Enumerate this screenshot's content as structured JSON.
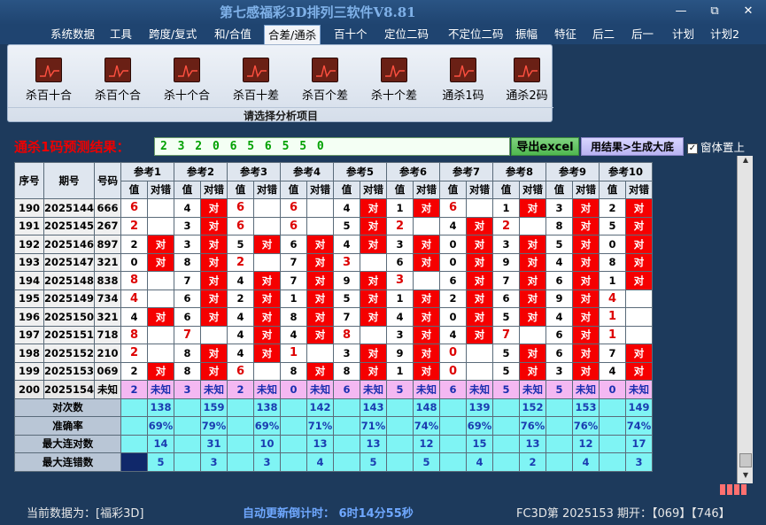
{
  "app_title": "第七感福彩3D排列三软件V8.81",
  "window_controls": {
    "minimize": "—",
    "maximize": "⧉",
    "close": "✕"
  },
  "menu": [
    "系统数据",
    "工具",
    "跨度/复式",
    "和/合值",
    "合差/通杀",
    "百十个",
    "定位二码",
    "不定位二码",
    "振幅",
    "特征",
    "后二",
    "后一",
    "计划",
    "计划2"
  ],
  "active_menu": "合差/通杀",
  "ribbon": {
    "buttons": [
      "杀百十合",
      "杀百个合",
      "杀十个合",
      "杀百十差",
      "杀百个差",
      "杀十个差",
      "通杀1码",
      "通杀2码"
    ],
    "caption": "请选择分析项目"
  },
  "prediction": {
    "label": "通杀1码预测结果：",
    "value": "2 3 2 0 6 5 6 5 5 0",
    "export_label": "导出excel",
    "generate_label": "用结果>生成大底",
    "ontop_label": "窗体置上",
    "ontop_checked": "✓"
  },
  "table": {
    "head_seq": "序号",
    "head_period": "期号",
    "head_num": "号码",
    "refs": [
      "参考1",
      "参考2",
      "参考3",
      "参考4",
      "参考5",
      "参考6",
      "参考7",
      "参考8",
      "参考9",
      "参考10"
    ],
    "sub_val": "值",
    "sub_result": "对错",
    "hit": "对",
    "rows": [
      {
        "seq": "190",
        "period": "2025144",
        "num": "666",
        "vals": [
          "6",
          "4",
          "6",
          "6",
          "4",
          "1",
          "6",
          "1",
          "3",
          "2"
        ],
        "hits": [
          0,
          1,
          0,
          0,
          1,
          1,
          0,
          1,
          1,
          1
        ]
      },
      {
        "seq": "191",
        "period": "2025145",
        "num": "267",
        "vals": [
          "2",
          "3",
          "6",
          "6",
          "5",
          "2",
          "4",
          "2",
          "8",
          "5"
        ],
        "hits": [
          0,
          1,
          0,
          0,
          1,
          0,
          1,
          0,
          1,
          1
        ]
      },
      {
        "seq": "192",
        "period": "2025146",
        "num": "897",
        "vals": [
          "2",
          "3",
          "5",
          "6",
          "4",
          "3",
          "0",
          "3",
          "5",
          "0"
        ],
        "hits": [
          1,
          1,
          1,
          1,
          1,
          1,
          1,
          1,
          1,
          1
        ]
      },
      {
        "seq": "193",
        "period": "2025147",
        "num": "321",
        "vals": [
          "0",
          "8",
          "2",
          "7",
          "3",
          "6",
          "0",
          "9",
          "4",
          "8"
        ],
        "hits": [
          1,
          1,
          0,
          1,
          0,
          1,
          1,
          1,
          1,
          1
        ]
      },
      {
        "seq": "194",
        "period": "2025148",
        "num": "838",
        "vals": [
          "8",
          "7",
          "4",
          "7",
          "9",
          "3",
          "6",
          "7",
          "6",
          "1"
        ],
        "hits": [
          0,
          1,
          1,
          1,
          1,
          0,
          1,
          1,
          1,
          1
        ]
      },
      {
        "seq": "195",
        "period": "2025149",
        "num": "734",
        "vals": [
          "4",
          "6",
          "2",
          "1",
          "5",
          "1",
          "2",
          "6",
          "9",
          "4"
        ],
        "hits": [
          0,
          1,
          1,
          1,
          1,
          1,
          1,
          1,
          1,
          0
        ]
      },
      {
        "seq": "196",
        "period": "2025150",
        "num": "321",
        "vals": [
          "4",
          "6",
          "4",
          "8",
          "7",
          "4",
          "0",
          "5",
          "4",
          "1"
        ],
        "hits": [
          1,
          1,
          1,
          1,
          1,
          1,
          1,
          1,
          1,
          0
        ]
      },
      {
        "seq": "197",
        "period": "2025151",
        "num": "718",
        "vals": [
          "8",
          "7",
          "4",
          "4",
          "8",
          "3",
          "4",
          "7",
          "6",
          "1"
        ],
        "hits": [
          0,
          0,
          1,
          1,
          0,
          1,
          1,
          0,
          1,
          0
        ]
      },
      {
        "seq": "198",
        "period": "2025152",
        "num": "210",
        "vals": [
          "2",
          "8",
          "4",
          "1",
          "3",
          "9",
          "0",
          "5",
          "6",
          "7"
        ],
        "hits": [
          0,
          1,
          1,
          0,
          1,
          1,
          0,
          1,
          1,
          1
        ]
      },
      {
        "seq": "199",
        "period": "2025153",
        "num": "069",
        "vals": [
          "2",
          "8",
          "6",
          "8",
          "8",
          "1",
          "0",
          "5",
          "3",
          "4"
        ],
        "hits": [
          1,
          1,
          0,
          1,
          1,
          1,
          0,
          1,
          1,
          1
        ]
      }
    ],
    "pred_row": {
      "seq": "200",
      "period": "2025154",
      "num": "未知",
      "vals": [
        "2",
        "3",
        "2",
        "0",
        "6",
        "5",
        "6",
        "5",
        "5",
        "0"
      ],
      "unknown": "未知"
    },
    "stats": [
      {
        "label": "对次数",
        "values": [
          "138",
          "159",
          "138",
          "142",
          "143",
          "148",
          "139",
          "152",
          "153",
          "149"
        ]
      },
      {
        "label": "准确率",
        "values": [
          "69%",
          "79%",
          "69%",
          "71%",
          "71%",
          "74%",
          "69%",
          "76%",
          "76%",
          "74%"
        ]
      },
      {
        "label": "最大连对数",
        "values": [
          "14",
          "31",
          "10",
          "13",
          "13",
          "12",
          "15",
          "13",
          "12",
          "17"
        ]
      },
      {
        "label": "最大连错数",
        "values": [
          "5",
          "3",
          "3",
          "4",
          "5",
          "5",
          "4",
          "2",
          "4",
          "3"
        ]
      }
    ]
  },
  "status": {
    "current": "当前数据为：[福彩3D]",
    "countdown": "自动更新倒计时： 6时14分55秒",
    "draw": "FC3D第 2025153 期开：【069】【746】"
  },
  "colors": {
    "hit_red": "#f50000",
    "accent_red": "#dd0000",
    "stat_cyan": "#7ff4f4",
    "pred_pink": "#f4b8f2"
  }
}
